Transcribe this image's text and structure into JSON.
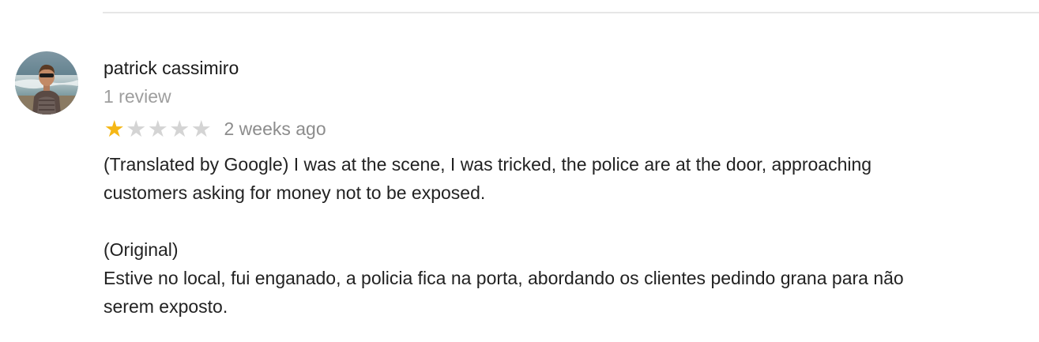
{
  "review": {
    "author_name": "patrick cassimiro",
    "author_meta": "1 review",
    "rating": 1,
    "rating_max": 5,
    "time_ago": "2 weeks ago",
    "translated_line1": "(Translated by Google) I was at the scene, I was tricked, the police are at the door, approaching",
    "translated_line2": "customers asking for money not to be exposed.",
    "original_label": "(Original)",
    "original_line1": "Estive no local, fui enganado,  a policia fica na porta, abordando os clientes pedindo grana para não",
    "original_line2": "serem exposto."
  },
  "colors": {
    "star_filled": "#f5b715",
    "star_empty": "#d4d4d4",
    "divider": "#e6e6e6",
    "muted_text": "#9e9e9e"
  },
  "icons": {
    "avatar": "profile-photo",
    "star": "star-icon"
  }
}
